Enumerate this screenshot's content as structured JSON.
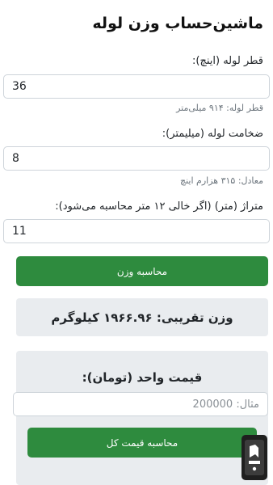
{
  "page": {
    "title": "ماشین‌حساب وزن لوله"
  },
  "diameter": {
    "label": "قطر لوله (اینچ):",
    "value": "36",
    "hint": "قطر لوله: ۹۱۴ میلی‌متر"
  },
  "thickness": {
    "label": "ضخامت لوله (میلیمتر):",
    "value": "8",
    "hint": "معادل: ۳۱۵ هزارم اینچ"
  },
  "length": {
    "label": "متراژ (متر) (اگر خالی ۱۲ متر محاسبه می‌شود):",
    "value": "11"
  },
  "calc_weight_button": "محاسبه وزن",
  "result": {
    "text": "وزن تقریبی: ۱۹۶۶.۹۶ کیلوگرم"
  },
  "price": {
    "title": "قیمت واحد (تومان):",
    "placeholder": "مثال: 200000",
    "button": "محاسبه قیمت کل"
  },
  "colors": {
    "accent": "#2e8b3e",
    "panel": "#e9ecef"
  },
  "icons": {
    "badge": "app-store-badge-icon"
  }
}
